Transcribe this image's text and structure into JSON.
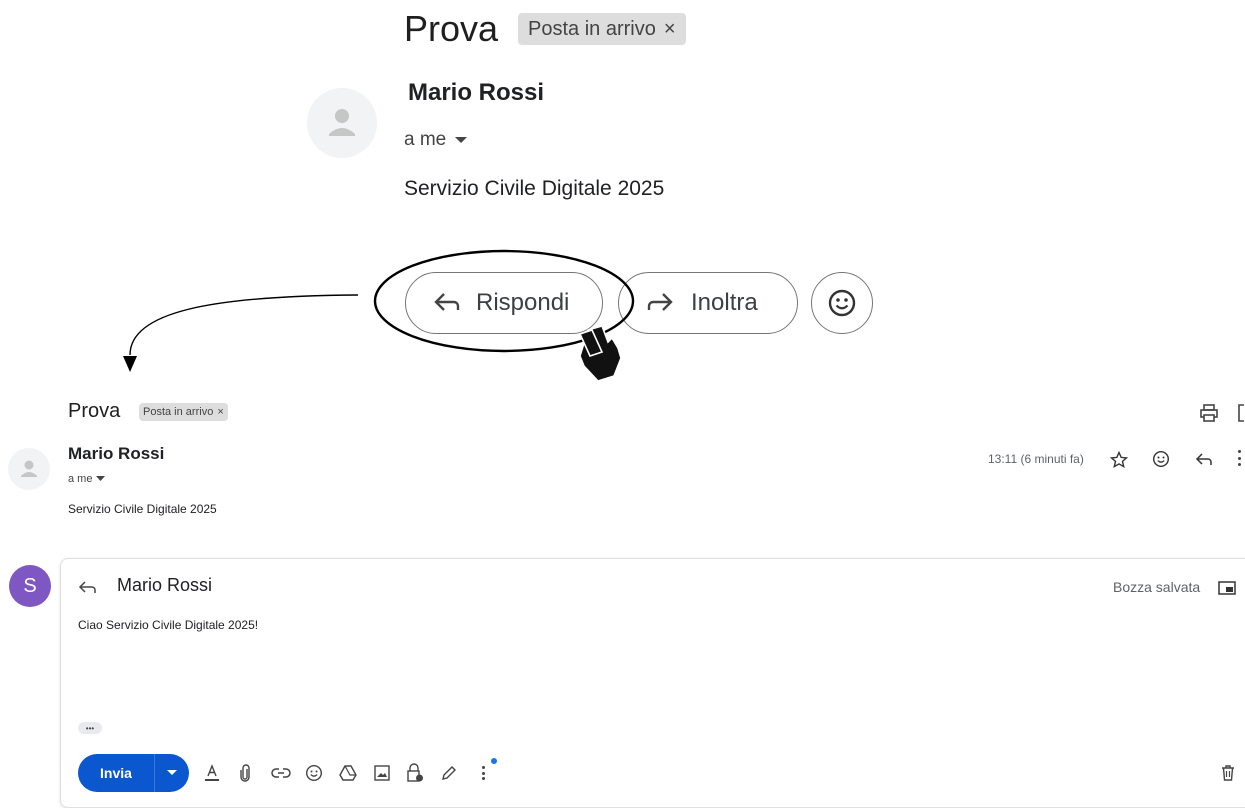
{
  "top": {
    "subject": "Prova",
    "label_chip": "Posta in arrivo",
    "chip_close": "×",
    "sender_name": "Mario Rossi",
    "recipient": "a me",
    "body": "Servizio Civile Digitale 2025",
    "reply_label": "Rispondi",
    "forward_label": "Inoltra"
  },
  "bottom": {
    "subject": "Prova",
    "label_chip": "Posta in arrivo",
    "chip_close": "×",
    "sender_name": "Mario Rossi",
    "recipient": "a me",
    "body": "Servizio Civile Digitale 2025",
    "timestamp": "13:11 (6 minuti fa)"
  },
  "compose": {
    "avatar_letter": "S",
    "to_name": "Mario Rossi",
    "draft_status": "Bozza salvata",
    "body_text": "Ciao Servizio Civile Digitale 2025!",
    "more_dots": "•••",
    "send_label": "Invia"
  },
  "colors": {
    "send_blue": "#0b57d0",
    "avatar_purple": "#7e57c2",
    "notification_dot": "#1a73e8"
  },
  "icons": [
    "person-icon",
    "caret-down-icon",
    "reply-arrow-icon",
    "forward-arrow-icon",
    "emoji-icon",
    "hand-cursor-icon",
    "print-icon",
    "star-icon",
    "trash-icon",
    "text-format-icon",
    "attach-icon",
    "link-icon",
    "drive-icon",
    "image-icon",
    "lock-clock-icon",
    "pen-icon",
    "more-vert-icon",
    "popout-icon"
  ]
}
